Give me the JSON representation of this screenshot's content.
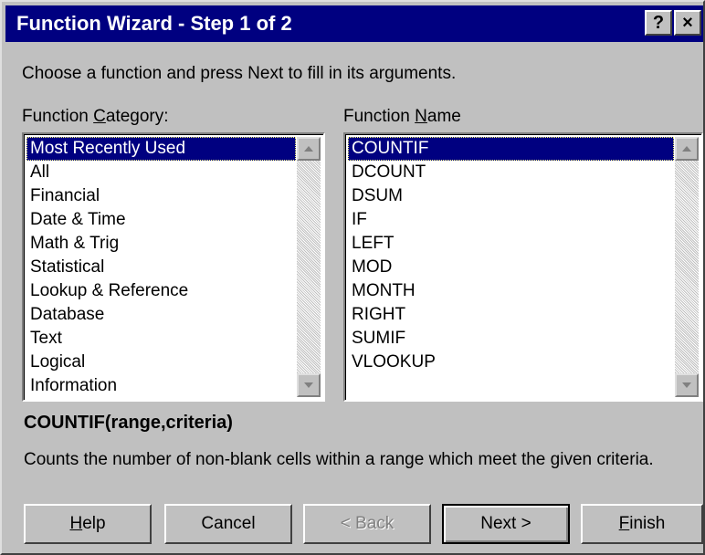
{
  "window": {
    "title": "Function Wizard - Step 1 of 2",
    "help_label": "?",
    "close_label": "×"
  },
  "instruction": "Choose a function and press Next to fill in its arguments.",
  "category": {
    "label_pre": "Function ",
    "label_mnemonic": "C",
    "label_post": "ategory:",
    "items": [
      "Most Recently Used",
      "All",
      "Financial",
      "Date & Time",
      "Math & Trig",
      "Statistical",
      "Lookup & Reference",
      "Database",
      "Text",
      "Logical",
      "Information"
    ],
    "selected": "Most Recently Used"
  },
  "name": {
    "label_pre": "Function ",
    "label_mnemonic": "N",
    "label_post": "ame",
    "items": [
      "COUNTIF",
      "DCOUNT",
      "DSUM",
      "IF",
      "LEFT",
      "MOD",
      "MONTH",
      "RIGHT",
      "SUMIF",
      "VLOOKUP"
    ],
    "selected": "COUNTIF"
  },
  "signature": "COUNTIF(range,criteria)",
  "description": "Counts the number of non-blank cells within a range which meet the given criteria.",
  "buttons": {
    "help": {
      "mnemonic": "H",
      "rest": "elp"
    },
    "cancel": {
      "label": "Cancel"
    },
    "back": {
      "label": "< Back",
      "disabled": true
    },
    "next": {
      "label": "Next >"
    },
    "finish": {
      "mnemonic": "F",
      "rest": "inish"
    }
  },
  "colors": {
    "selection": "#000080",
    "face": "#c0c0c0",
    "title_bar": "#000080"
  }
}
